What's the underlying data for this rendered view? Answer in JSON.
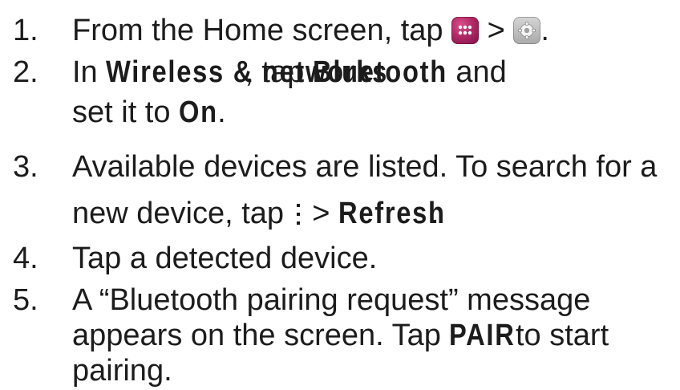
{
  "steps": [
    {
      "number": "1.",
      "lines": [
        {
          "text_a": "From the Home screen, tap",
          "sep": ">",
          "end": "."
        }
      ],
      "icons": [
        "apps-icon",
        "settings-icon"
      ]
    },
    {
      "number": "2.",
      "line1_a": "In",
      "line1_bold1": "Wireless & networks",
      "line1_b": ", tap",
      "line1_bold2": "Bluetooth",
      "line1_c": "and",
      "line2_a": "set it to",
      "line2_bold": "On",
      "line2_b": "."
    },
    {
      "number": "3.",
      "line1": "Available devices are listed. To search for a",
      "line2_a": "new device, tap",
      "line2_sep": ">",
      "line2_bold": "Refresh",
      "line2_b": ".",
      "icon": "more-options-icon"
    },
    {
      "number": "4.",
      "line1": "Tap a detected device."
    },
    {
      "number": "5.",
      "line1": "A “Bluetooth pairing request” message",
      "line2_a": "appears on the screen. Tap",
      "line2_bold": "PAIR",
      "line2_b": "to start",
      "line3": "pairing."
    }
  ],
  "colors": {
    "text": "#1c1c1c",
    "apps_icon": "#b02a66",
    "settings_icon": "#b8b8b8",
    "background": "#ffffff"
  }
}
